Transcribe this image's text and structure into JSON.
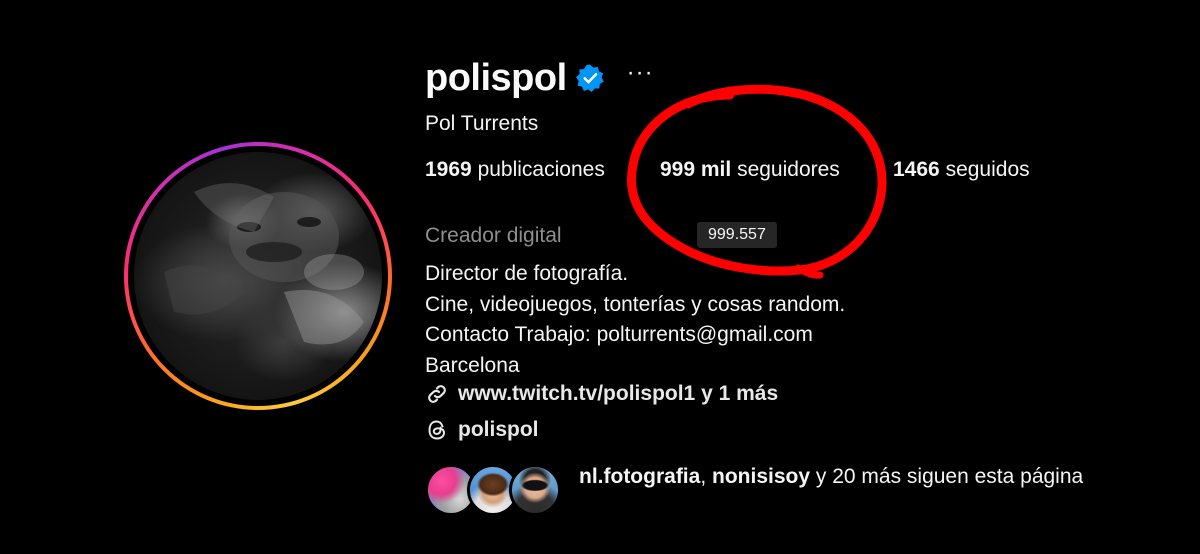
{
  "profile": {
    "username": "polispol",
    "more_label": "···",
    "full_name": "Pol Turrents",
    "verified": true
  },
  "stats": {
    "posts_count": "1969",
    "posts_label": "publicaciones",
    "followers_count": "999 mil",
    "followers_label": "seguidores",
    "following_count": "1466",
    "following_label": "seguidos",
    "followers_tooltip": "999.557"
  },
  "bio": {
    "category": "Creador digital",
    "lines": [
      "Director de fotografía.",
      "Cine, videojuegos, tonterías y cosas random.",
      "Contacto Trabajo: polturrents@gmail.com",
      "Barcelona"
    ],
    "link_text": "www.twitch.tv/polispol1 y 1 más",
    "threads_handle": "polispol"
  },
  "followed_by": {
    "name_1": "nl.fotografia",
    "separator": ", ",
    "name_2": "nonisisoy",
    "suffix": " y 20 más siguen esta página"
  },
  "colors": {
    "background": "#000000",
    "verified_blue": "#0095f6",
    "annotation_red": "#ff0000",
    "category_gray": "#8e8e8e"
  },
  "icons": {
    "verified": "verified-badge-icon",
    "more": "more-options-icon",
    "link": "link-icon",
    "threads": "threads-icon"
  }
}
